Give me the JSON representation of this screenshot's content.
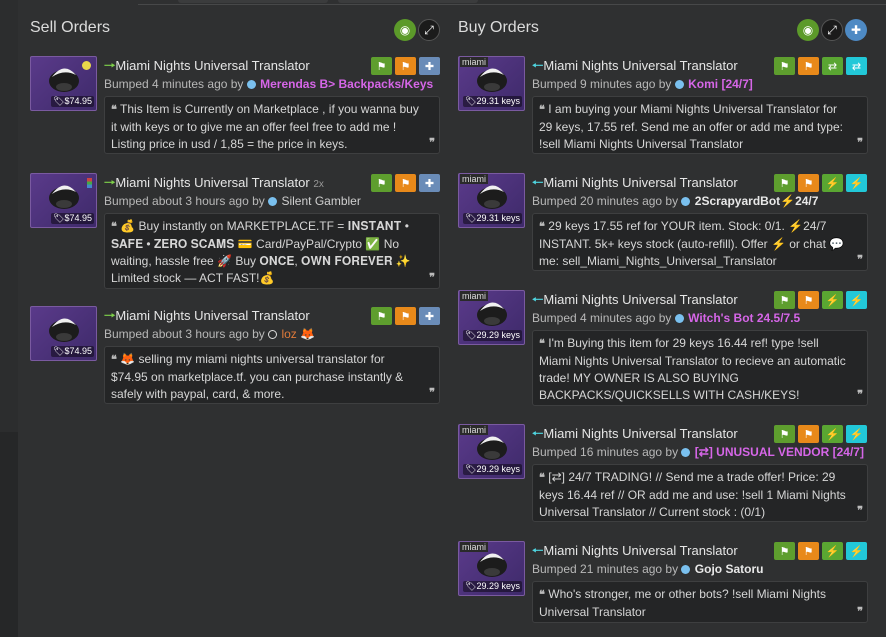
{
  "sell": {
    "title": "Sell Orders",
    "listings": [
      {
        "item_name": "Miami Nights Universal Translator",
        "multiplier": "",
        "price": "$74.95",
        "bumped": "Bumped 4 minutes ago by",
        "user": "Merendas B> Backpacks/Keys",
        "comment": "This Item is Currently on Marketplace , if you wanna buy it with keys or to give me an offer feel free to add me ! Listing price in usd / 1,85 = the price in keys."
      },
      {
        "item_name": "Miami Nights Universal Translator",
        "multiplier": "2x",
        "price": "$74.95",
        "bumped": "Bumped about 3 hours ago by",
        "user": "Silent Gambler",
        "comment": "💰 Buy instantly on MARKETPLACE.TF = 𝐈𝐍𝐒𝐓𝐀𝐍𝐓 • 𝐒𝐀𝐅𝐄 • 𝐙𝐄𝐑𝐎 𝐒𝐂𝐀𝐌𝐒 💳 Card/PayPal/Crypto ✅ No waiting, hassle free 🚀 Buy 𝐎𝐍𝐂𝐄, 𝐎𝐖𝐍 𝐅𝐎𝐑𝐄𝐕𝐄𝐑 ✨ Limited stock — ACT FAST!💰"
      },
      {
        "item_name": "Miami Nights Universal Translator",
        "multiplier": "",
        "price": "$74.95",
        "bumped": "Bumped about 3 hours ago by",
        "user": "loz",
        "comment": "🦊 selling my miami nights universal translator for $74.95 on marketplace.tf. you can purchase instantly & safely with paypal, card, & more."
      }
    ]
  },
  "buy": {
    "title": "Buy Orders",
    "listings": [
      {
        "item_name": "Miami Nights Universal Translator",
        "tag": "miami",
        "price": "29.31 keys",
        "bumped": "Bumped 9 minutes ago by",
        "user": "Komi [24/7]",
        "comment": "I am buying your Miami Nights Universal Translator for 29 keys, 17.55 ref. Send me an offer or add me and type: !sell Miami Nights Universal Translator"
      },
      {
        "item_name": "Miami Nights Universal Translator",
        "tag": "miami",
        "price": "29.31 keys",
        "bumped": "Bumped 20 minutes ago by",
        "user": "2ScrapyardBot⚡24/7",
        "comment": "29 keys 17.55 ref for YOUR item. Stock: 0/1. ⚡24/7 INSTANT. 5k+ keys stock (auto-refill). Offer ⚡ or chat 💬 me: sell_Miami_Nights_Universal_Translator"
      },
      {
        "item_name": "Miami Nights Universal Translator",
        "tag": "miami",
        "price": "29.29 keys",
        "bumped": "Bumped 4 minutes ago by",
        "user": "Witch's Bot 24.5/7.5",
        "comment": "I'm Buying this item for 29 keys 16.44 ref! type !sell Miami Nights Universal Translator to recieve an automatic trade! MY OWNER IS ALSO BUYING BACKPACKS/QUICKSELLS WITH CASH/KEYS!"
      },
      {
        "item_name": "Miami Nights Universal Translator",
        "tag": "miami",
        "price": "29.29 keys",
        "bumped": "Bumped 16 minutes ago by",
        "user": "[⇄] UNUSUAL VENDOR [24/7]",
        "comment": "[⇄] 24/7 TRADING! // Send me a trade offer! Price: 29 keys 16.44 ref // OR add me and use: !sell 1 Miami Nights Universal Translator // Current stock : (0/1)"
      },
      {
        "item_name": "Miami Nights Universal Translator",
        "tag": "miami",
        "price": "29.29 keys",
        "bumped": "Bumped 21 minutes ago by",
        "user": "Gojo Satoru",
        "comment": "Who's stronger, me or other bots? !sell Miami Nights Universal Translator"
      }
    ]
  },
  "icons": {
    "visibility": "eye-icon",
    "expand": "expand-icon",
    "add": "plus-icon",
    "tag": "tag-icon",
    "report": "flag-icon",
    "add_friend": "user-plus-icon",
    "trade": "exchange-icon",
    "instant": "lightning-icon"
  },
  "colors": {
    "sell_arrow": "#7ed04a",
    "buy_arrow": "#4fd5e0",
    "pink_user": "#d666e8",
    "badge_green": "#5e9e2e",
    "badge_orange": "#e8891a",
    "badge_cyan": "#22c8d8"
  }
}
